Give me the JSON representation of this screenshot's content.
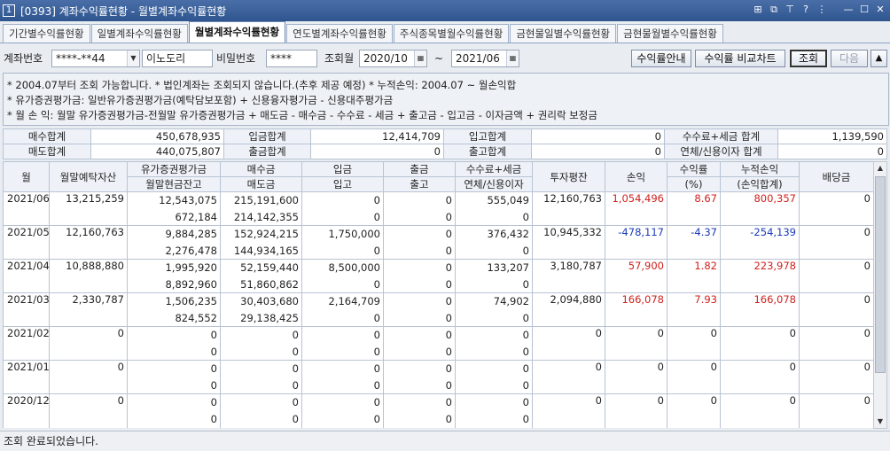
{
  "window": {
    "number": "1",
    "title": "[0393] 계좌수익률현황 - 월별계좌수익률현황"
  },
  "tabs": [
    "기간별수익률현황",
    "일별계좌수익률현황",
    "월별계좌수익률현황",
    "연도별계좌수익률현황",
    "주식종목별월수익률현황",
    "금현물일별수익률현황",
    "금현물월별수익률현황"
  ],
  "active_tab": 2,
  "query": {
    "account_label": "계좌번호",
    "account_value": "****-**44",
    "account_name": "이노도리",
    "password_label": "비밀번호",
    "password_value": "****",
    "month_label": "조회월",
    "from": "2020/10",
    "tilde": "~",
    "to": "2021/06",
    "btn_guide": "수익률안내",
    "btn_compare": "수익률 비교차트",
    "btn_search": "조회",
    "btn_next": "다음",
    "btn_up": "▲"
  },
  "notes": [
    "* 2004.07부터 조회 가능합니다.  * 법인계좌는 조회되지 않습니다.(추후 제공 예정)  * 누적손익: 2004.07 ~ 월손익합",
    "* 유가증권평가금: 일반유가증권평가금(예탁담보포함) + 신용융자평가금 - 신용대주평가금",
    "* 월 손 익: 월말 유가증권평가금-전월말 유가증권평가금 + 매도금 - 매수금 - 수수료 - 세금 + 출고금 - 입고금 - 이자금액 + 권리락 보정금"
  ],
  "summary": [
    [
      "매수합계",
      "450,678,935",
      "입금합계",
      "12,414,709",
      "입고합계",
      "0",
      "수수료+세금 합계",
      "1,139,590"
    ],
    [
      "매도합계",
      "440,075,807",
      "출금합계",
      "0",
      "출고합계",
      "0",
      "연체/신용이자 합계",
      "0"
    ]
  ],
  "headers": {
    "month": "월",
    "deposit": "월말예탁자산",
    "eval_top": "유가증권평가금",
    "eval_bottom": "월말현금잔고",
    "buy_top": "매수금",
    "buy_bottom": "매도금",
    "in_top": "입금",
    "in_bottom": "입고",
    "out_top": "출금",
    "out_bottom": "출고",
    "fee_top": "수수료+세금",
    "fee_bottom": "연체/신용이자",
    "avg": "투자평잔",
    "pl": "손익",
    "rate_top": "수익률",
    "rate_bottom": "(%)",
    "cum_top": "누적손익",
    "cum_bottom": "(손익합계)",
    "div": "배당금"
  },
  "rows": [
    {
      "month": "2021/06",
      "deposit": "13,215,259",
      "eval": "12,543,075",
      "cash": "672,184",
      "buy": "215,191,600",
      "sell": "214,142,355",
      "in": "0",
      "inq": "0",
      "out": "0",
      "outq": "0",
      "fee": "555,049",
      "interest": "0",
      "avg": "12,160,763",
      "pl": "1,054,496",
      "rate": "8.67",
      "cum": "800,357",
      "div": "0",
      "sign": "pos"
    },
    {
      "month": "2021/05",
      "deposit": "12,160,763",
      "eval": "9,884,285",
      "cash": "2,276,478",
      "buy": "152,924,215",
      "sell": "144,934,165",
      "in": "1,750,000",
      "inq": "0",
      "out": "0",
      "outq": "0",
      "fee": "376,432",
      "interest": "0",
      "avg": "10,945,332",
      "pl": "-478,117",
      "rate": "-4.37",
      "cum": "-254,139",
      "div": "0",
      "sign": "neg"
    },
    {
      "month": "2021/04",
      "deposit": "10,888,880",
      "eval": "1,995,920",
      "cash": "8,892,960",
      "buy": "52,159,440",
      "sell": "51,860,862",
      "in": "8,500,000",
      "inq": "0",
      "out": "0",
      "outq": "0",
      "fee": "133,207",
      "interest": "0",
      "avg": "3,180,787",
      "pl": "57,900",
      "rate": "1.82",
      "cum": "223,978",
      "div": "0",
      "sign": "pos"
    },
    {
      "month": "2021/03",
      "deposit": "2,330,787",
      "eval": "1,506,235",
      "cash": "824,552",
      "buy": "30,403,680",
      "sell": "29,138,425",
      "in": "2,164,709",
      "inq": "0",
      "out": "0",
      "outq": "0",
      "fee": "74,902",
      "interest": "0",
      "avg": "2,094,880",
      "pl": "166,078",
      "rate": "7.93",
      "cum": "166,078",
      "div": "0",
      "sign": "pos"
    },
    {
      "month": "2021/02",
      "deposit": "0",
      "eval": "0",
      "cash": "0",
      "buy": "0",
      "sell": "0",
      "in": "0",
      "inq": "0",
      "out": "0",
      "outq": "0",
      "fee": "0",
      "interest": "0",
      "avg": "0",
      "pl": "0",
      "rate": "0",
      "cum": "0",
      "div": "0",
      "sign": "zero"
    },
    {
      "month": "2021/01",
      "deposit": "0",
      "eval": "0",
      "cash": "0",
      "buy": "0",
      "sell": "0",
      "in": "0",
      "inq": "0",
      "out": "0",
      "outq": "0",
      "fee": "0",
      "interest": "0",
      "avg": "0",
      "pl": "0",
      "rate": "0",
      "cum": "0",
      "div": "0",
      "sign": "zero"
    },
    {
      "month": "2020/12",
      "deposit": "0",
      "eval": "0",
      "cash": "0",
      "buy": "0",
      "sell": "0",
      "in": "0",
      "inq": "0",
      "out": "0",
      "outq": "0",
      "fee": "0",
      "interest": "0",
      "avg": "0",
      "pl": "0",
      "rate": "0",
      "cum": "0",
      "div": "0",
      "sign": "zero"
    }
  ],
  "status": "조회 완료되었습니다.",
  "colors": {
    "positive": "#d0201c",
    "negative": "#1a3ab8",
    "titlebar": "#3a5f9a"
  }
}
